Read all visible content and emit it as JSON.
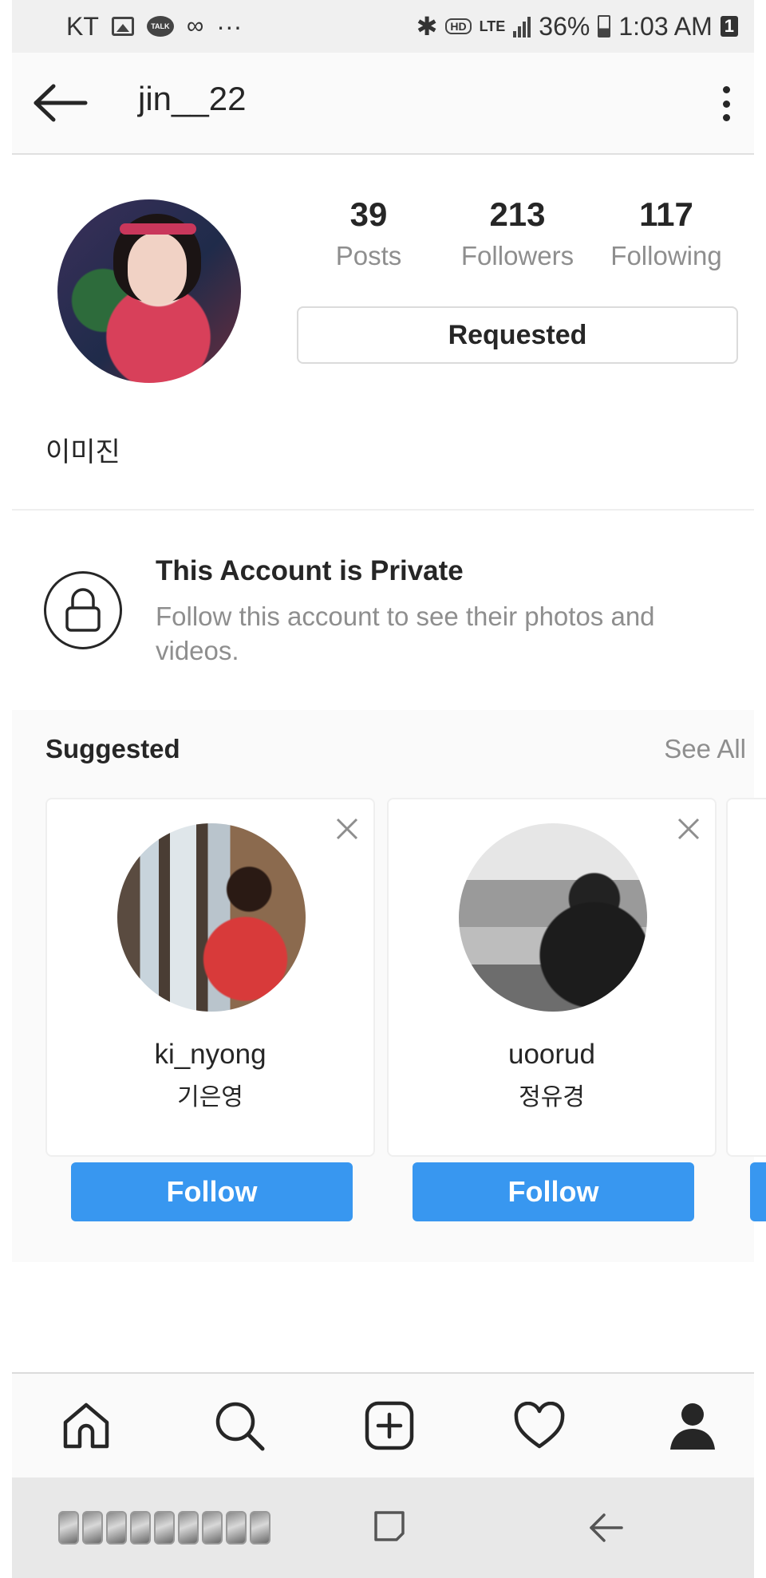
{
  "status_bar": {
    "carrier": "KT",
    "talk_label": "TALK",
    "hd_label": "HD",
    "network": "LTE",
    "battery_percent": "36%",
    "time": "1:03 AM",
    "notification_count": "1",
    "dots": "···"
  },
  "header": {
    "username": "jin__22"
  },
  "profile": {
    "stats": [
      {
        "value": "39",
        "label": "Posts"
      },
      {
        "value": "213",
        "label": "Followers"
      },
      {
        "value": "117",
        "label": "Following"
      }
    ],
    "requested_label": "Requested",
    "display_name": "이미진"
  },
  "private_notice": {
    "title": "This Account is Private",
    "description": "Follow this account to see their photos and videos."
  },
  "suggested": {
    "title": "Suggested",
    "see_all_label": "See All",
    "cards": [
      {
        "username": "ki_nyong",
        "name": "기은영",
        "follow_label": "Follow"
      },
      {
        "username": "uoorud",
        "name": "정유경",
        "follow_label": "Follow"
      }
    ]
  },
  "bottom_nav": {
    "items": [
      "home-icon",
      "search-icon",
      "add-post-icon",
      "heart-icon",
      "profile-icon"
    ],
    "active": "profile-icon"
  },
  "colors": {
    "accent": "#3897f0",
    "text_primary": "#262626",
    "text_secondary": "#8e8e8e",
    "border": "#dbdbdb"
  }
}
